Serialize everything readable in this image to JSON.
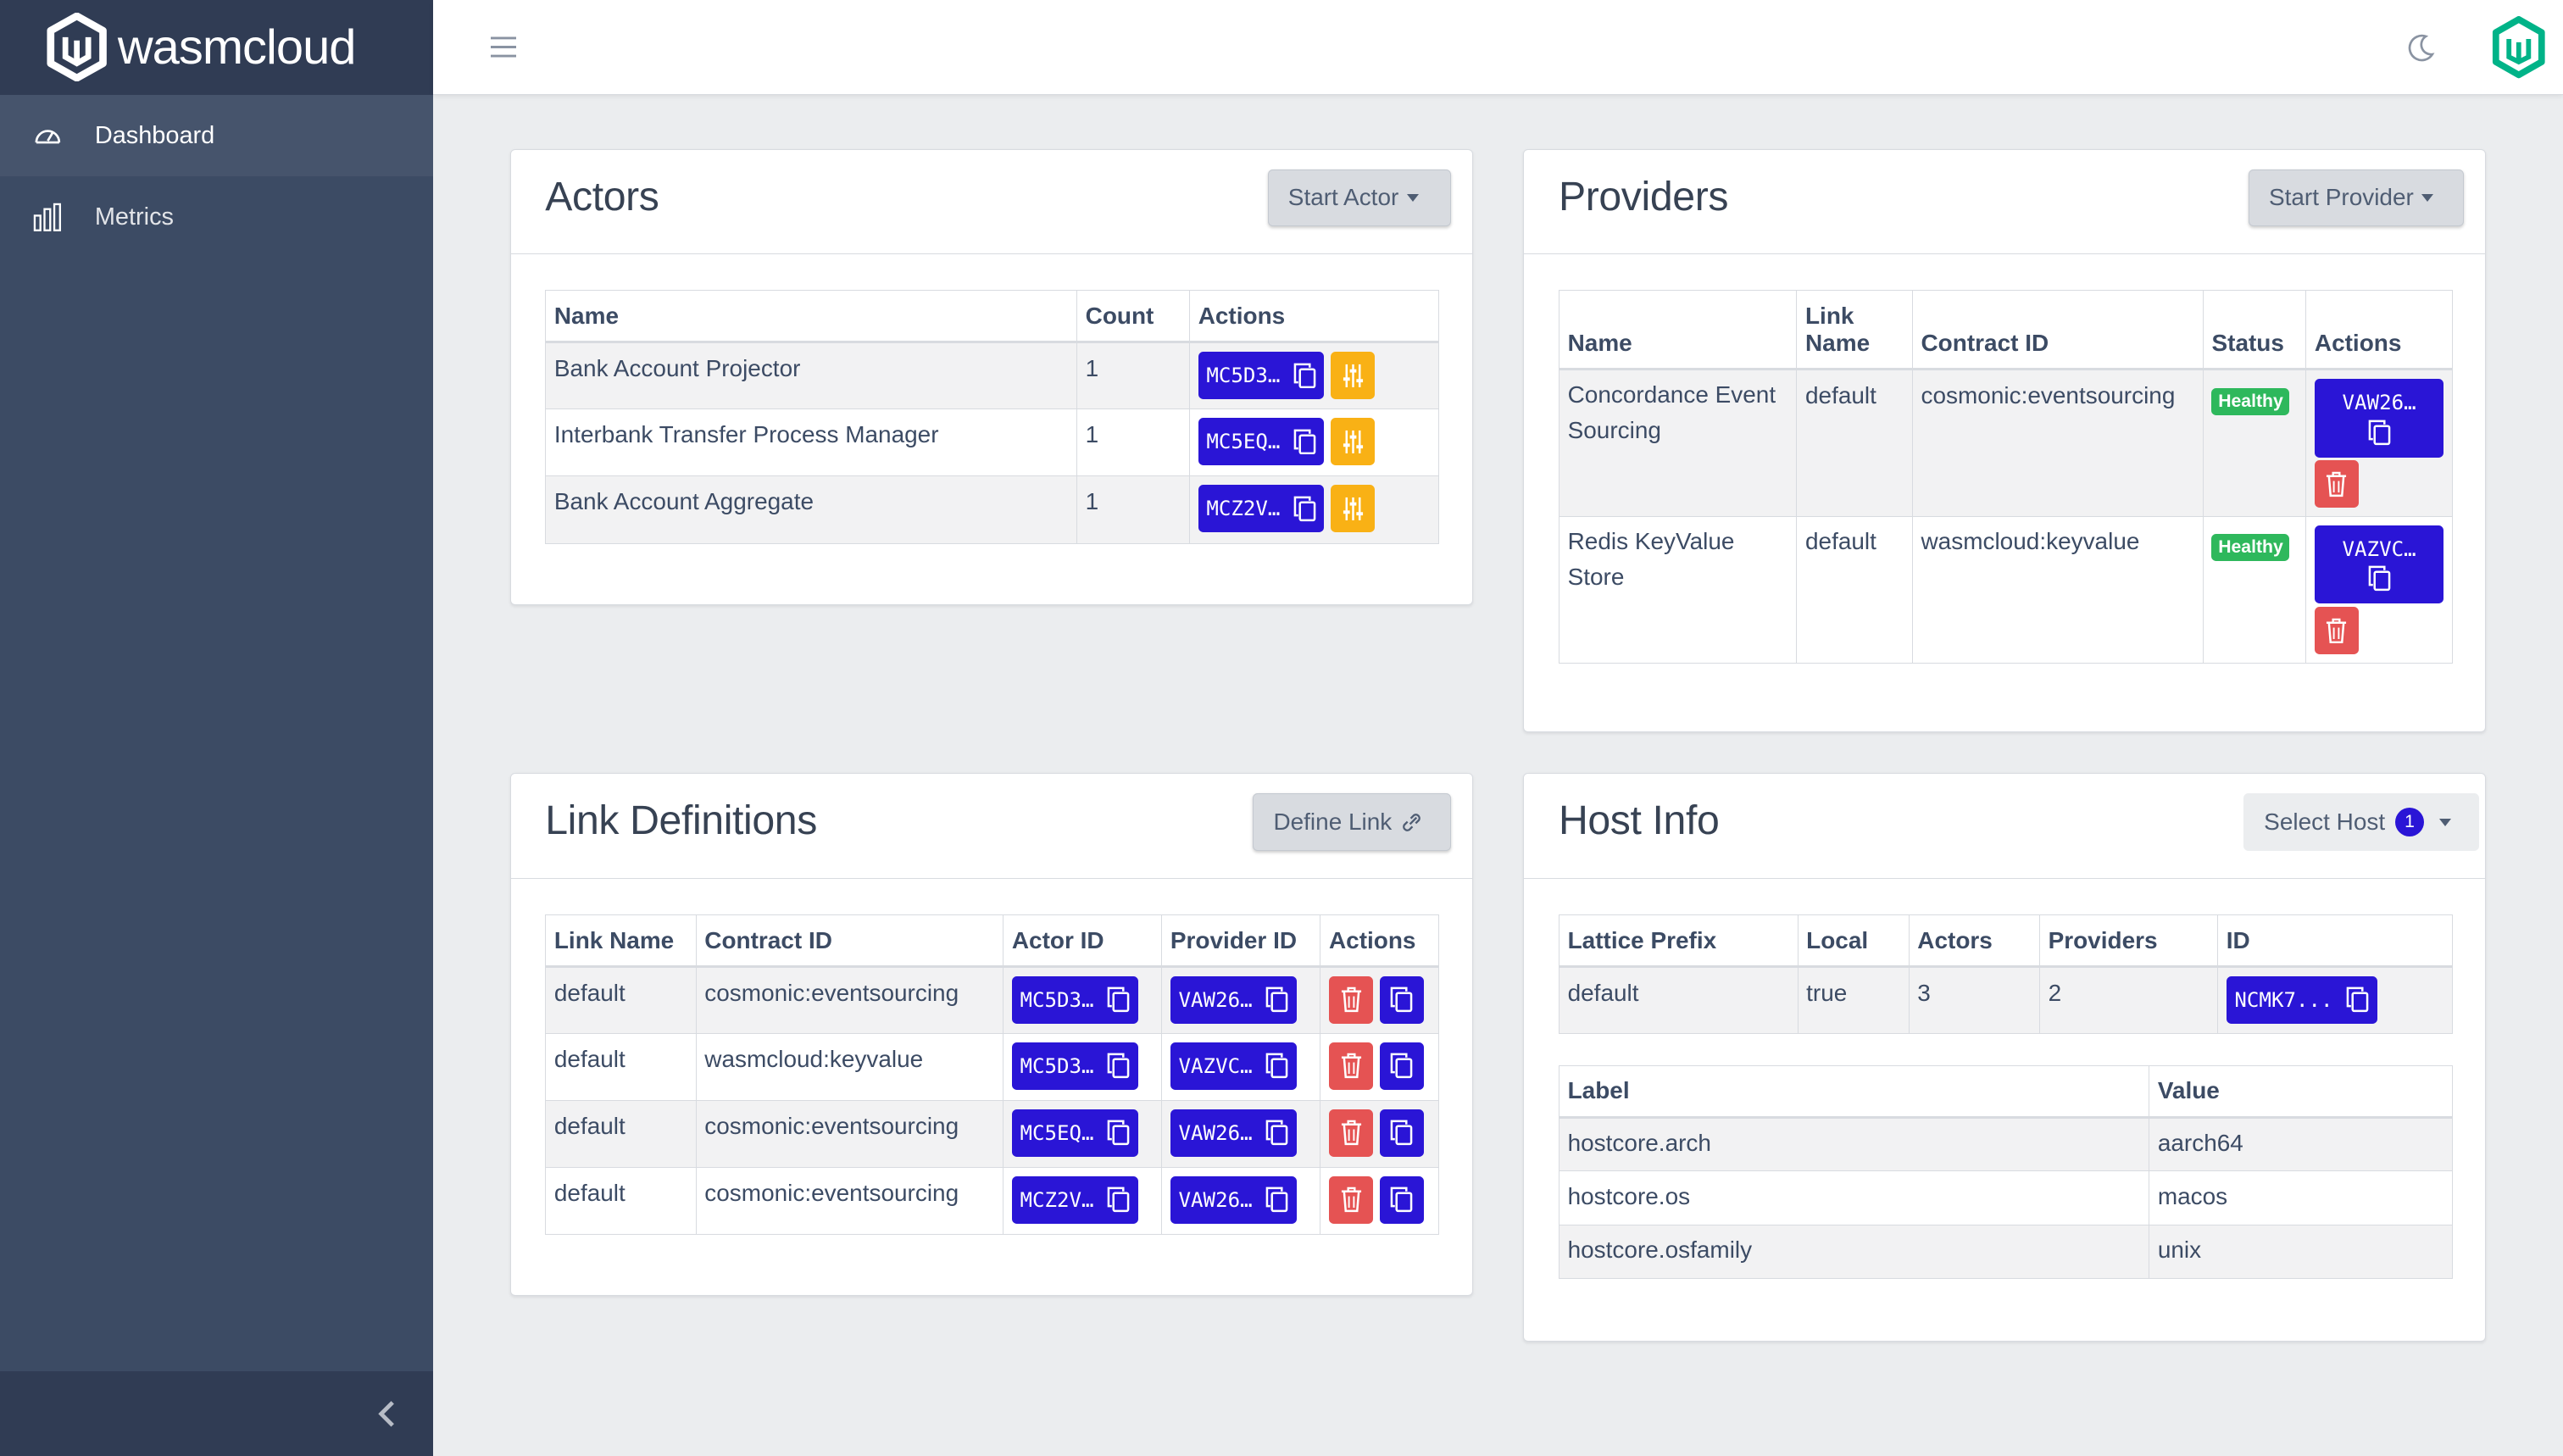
{
  "brand": {
    "name": "wasmcloud"
  },
  "sidebar": {
    "items": [
      {
        "label": "Dashboard",
        "icon": "speedometer-icon"
      },
      {
        "label": "Metrics",
        "icon": "bar-chart-icon"
      }
    ]
  },
  "actors": {
    "title": "Actors",
    "start_label": "Start Actor",
    "headers": [
      "Name",
      "Count",
      "Actions"
    ],
    "rows": [
      {
        "name": "Bank Account Projector",
        "count": "1",
        "id": "MC5D3…"
      },
      {
        "name": "Interbank Transfer Process Manager",
        "count": "1",
        "id": "MC5EQ…"
      },
      {
        "name": "Bank Account Aggregate",
        "count": "1",
        "id": "MCZ2V…"
      }
    ]
  },
  "providers": {
    "title": "Providers",
    "start_label": "Start Provider",
    "headers": [
      "Name",
      "Link Name",
      "Contract ID",
      "Status",
      "Actions"
    ],
    "rows": [
      {
        "name": "Concordance Event Sourcing",
        "link": "default",
        "contract": "cosmonic:eventsourcing",
        "status": "Healthy",
        "id": "VAW26…"
      },
      {
        "name": "Redis KeyValue Store",
        "link": "default",
        "contract": "wasmcloud:keyvalue",
        "status": "Healthy",
        "id": "VAZVC…"
      }
    ]
  },
  "links": {
    "title": "Link Definitions",
    "define_label": "Define Link",
    "headers": [
      "Link Name",
      "Contract ID",
      "Actor ID",
      "Provider ID",
      "Actions"
    ],
    "rows": [
      {
        "link": "default",
        "contract": "cosmonic:eventsourcing",
        "actor": "MC5D3…",
        "provider": "VAW26…"
      },
      {
        "link": "default",
        "contract": "wasmcloud:keyvalue",
        "actor": "MC5D3…",
        "provider": "VAZVC…"
      },
      {
        "link": "default",
        "contract": "cosmonic:eventsourcing",
        "actor": "MC5EQ…",
        "provider": "VAW26…"
      },
      {
        "link": "default",
        "contract": "cosmonic:eventsourcing",
        "actor": "MCZ2V…",
        "provider": "VAW26…"
      }
    ]
  },
  "host": {
    "title": "Host Info",
    "select_label": "Select Host",
    "host_count": "1",
    "headers": [
      "Lattice Prefix",
      "Local",
      "Actors",
      "Providers",
      "ID"
    ],
    "row": {
      "prefix": "default",
      "local": "true",
      "actors": "3",
      "providers": "2",
      "id": "NCMK7..."
    },
    "label_headers": [
      "Label",
      "Value"
    ],
    "labels": [
      {
        "label": "hostcore.arch",
        "value": "aarch64"
      },
      {
        "label": "hostcore.os",
        "value": "macos"
      },
      {
        "label": "hostcore.osfamily",
        "value": "unix"
      }
    ]
  },
  "colors": {
    "primary": "#2a15d6",
    "sidebar": "#3c4b64",
    "success": "#2eb85c",
    "danger": "#e55353",
    "warning": "#f9b115"
  }
}
